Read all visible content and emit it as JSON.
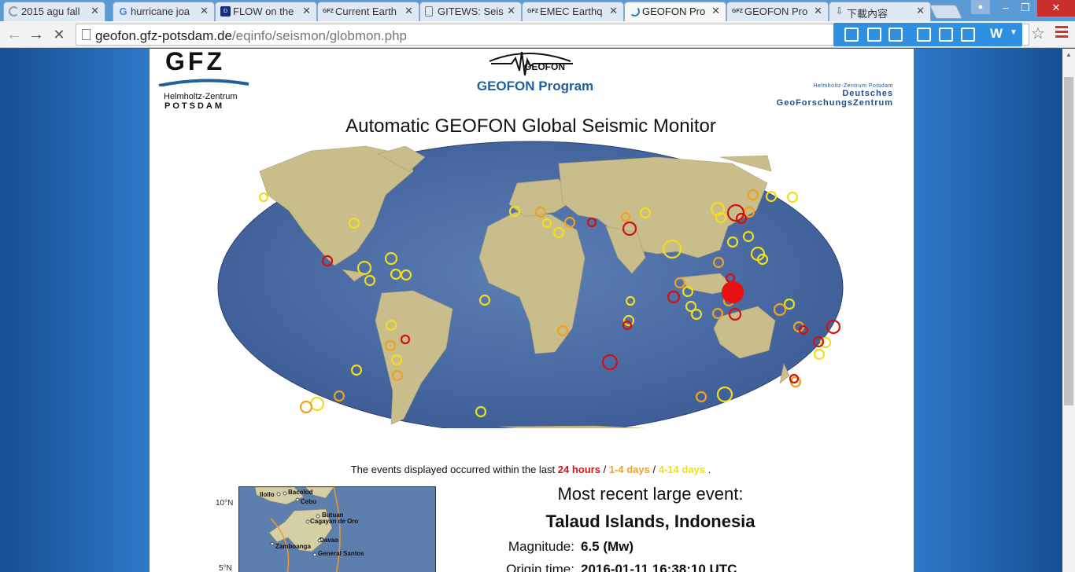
{
  "browser": {
    "tabs": [
      {
        "label": "2015 agu fall",
        "icon": "loading-icon"
      },
      {
        "label": "hurricane joa",
        "icon": "google-icon"
      },
      {
        "label": "FLOW on the",
        "icon": "darts-icon"
      },
      {
        "label": "Current Earth",
        "icon": "gfz-icon"
      },
      {
        "label": "GITEWS: Seis",
        "icon": "page-icon"
      },
      {
        "label": "EMEC Earthq",
        "icon": "gfz-icon"
      },
      {
        "label": "GEOFON Pro",
        "icon": "loading-icon"
      },
      {
        "label": "GEOFON Pro",
        "icon": "gfz-icon"
      },
      {
        "label": "下載內容",
        "icon": "download-icon"
      }
    ],
    "active_tab": 6,
    "url_host": "geofon.gfz-potsdam.de",
    "url_path": "/eqinfo/seismon/globmon.php"
  },
  "header": {
    "gfz_logo": "GFZ",
    "gfz_line1": "Helmholtz-Zentrum",
    "gfz_line2": "POTSDAM",
    "geofon_logo": "GEOFON",
    "program": "GEOFON Program",
    "right_line1": "Helmholtz-Zentrum Potsdam",
    "right_line2": "Deutsches",
    "right_line3": "GeoForschungsZentrum"
  },
  "title": "Automatic GEOFON Global Seismic Monitor",
  "legend": {
    "prefix": "The events displayed occurred within the last",
    "c1": "24 hours",
    "c2": "1-4 days",
    "c3": "4-14 days",
    "sep": "/",
    "suffix": ".",
    "colors": {
      "recent": "#d11111",
      "mid": "#f0a21c",
      "old": "#f0de1c"
    }
  },
  "minimap": {
    "lat_top": "10°N",
    "lat_bottom": "5°N",
    "places": [
      "Iloilo",
      "Bacolod",
      "Cebu",
      "Butuan",
      "Cagayan de Oro",
      "Davao",
      "Zamboanga",
      "General Santos"
    ]
  },
  "recent": {
    "title": "Most recent large event:",
    "region": "Talaud Islands, Indonesia",
    "magnitude_label": "Magnitude:",
    "magnitude_value": "6.5 (Mw)",
    "origin_label": "Origin time:",
    "origin_value": "2016-01-11 16:38:10 UTC"
  }
}
